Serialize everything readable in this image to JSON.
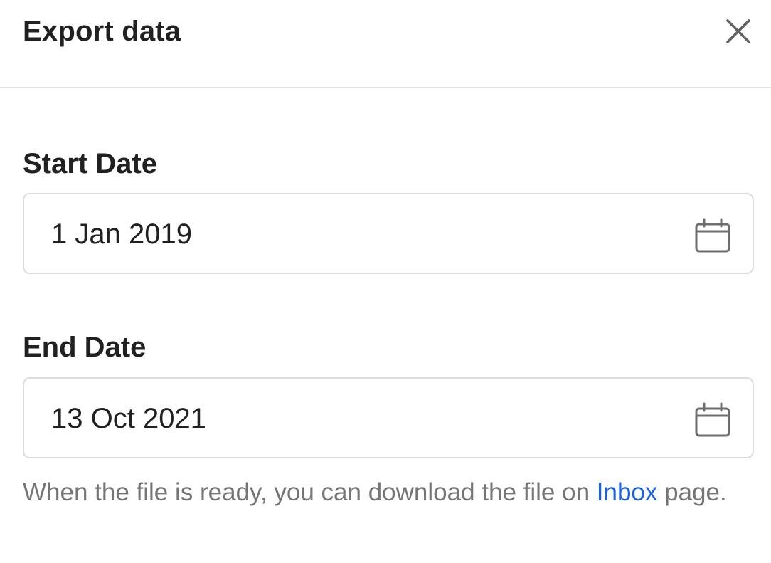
{
  "dialog": {
    "title": "Export data",
    "close_icon": "close-icon"
  },
  "start_date": {
    "label": "Start Date",
    "value": "1 Jan 2019",
    "icon": "calendar-icon"
  },
  "end_date": {
    "label": "End Date",
    "value": "13 Oct 2021",
    "icon": "calendar-icon"
  },
  "helper": {
    "text_before": "When the file is ready, you can download the file on ",
    "link_label": "Inbox",
    "text_after": " page."
  },
  "colors": {
    "link": "#1a5fe8",
    "text": "#212121",
    "muted": "#757575",
    "border": "#dcdcdc"
  }
}
